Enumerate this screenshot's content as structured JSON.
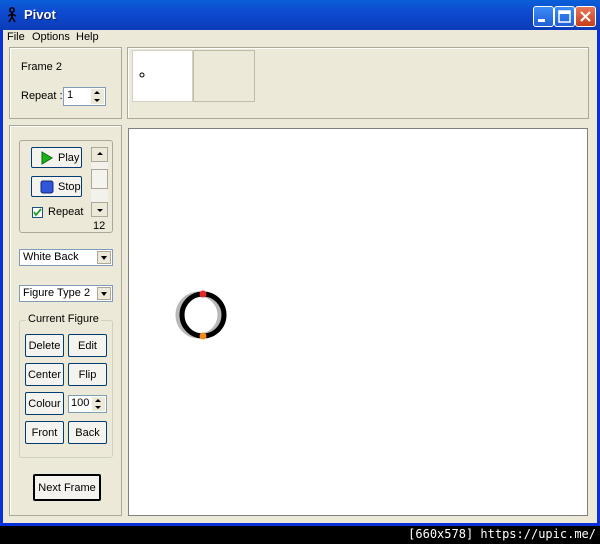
{
  "window": {
    "title": "Pivot"
  },
  "menu": [
    "File",
    "Options",
    "Help"
  ],
  "frame_panel": {
    "frame_label": "Frame 2",
    "repeat_label": "Repeat :",
    "repeat_value": "1"
  },
  "playback": {
    "play_label": "Play",
    "stop_label": "Stop",
    "repeat_checkbox_label": "Repeat",
    "repeat_checked": true,
    "speed_value": "12"
  },
  "background_select": {
    "value": "White Back"
  },
  "figure_type_select": {
    "value": "Figure Type 2"
  },
  "current_figure": {
    "title": "Current Figure",
    "delete_label": "Delete",
    "edit_label": "Edit",
    "center_label": "Center",
    "flip_label": "Flip",
    "colour_label": "Colour",
    "colour_value": "100",
    "front_label": "Front",
    "back_label": "Back"
  },
  "next_frame_label": "Next Frame",
  "watermark": "[660x578] https://upic.me/",
  "colors": {
    "accent_red": "#e82828",
    "accent_orange": "#f08a1c",
    "figure_black": "#000000",
    "shadow_gray": "#b8b8b8"
  }
}
